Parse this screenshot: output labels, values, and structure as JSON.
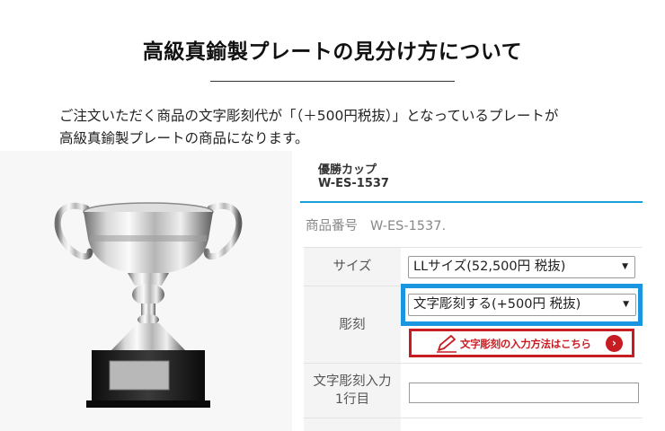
{
  "page": {
    "title": "高級真鍮製プレートの見分け方について",
    "intro_line1": "ご注文いただく商品の文字彫刻代が「（＋500円税抜）」となっているプレートが",
    "intro_line2": "高級真鍮製プレートの商品になります。"
  },
  "product": {
    "name": "優勝カップ",
    "code": "W-ES-1537",
    "item_number_label": "商品番号",
    "item_number_value": "W-ES-1537."
  },
  "options": {
    "size_label": "サイズ",
    "size_value": "LLサイズ(52,500円 税抜)",
    "engrave_label": "彫刻",
    "engrave_value": "文字彫刻する(+500円 税抜)",
    "engrave_link_label": "文字彫刻の入力方法はこちら",
    "line1_label_a": "文字彫刻入力",
    "line1_label_b": "1行目",
    "line1_value": ""
  },
  "icons": {
    "select_arrow": "▼",
    "link_arrow": "›",
    "pencil": "pencil-icon",
    "chevron": "chevron-right-icon"
  },
  "colors": {
    "highlight_blue": "#1a96e0",
    "accent_red": "#c81c23",
    "header_underline": "#1aa0d8"
  }
}
